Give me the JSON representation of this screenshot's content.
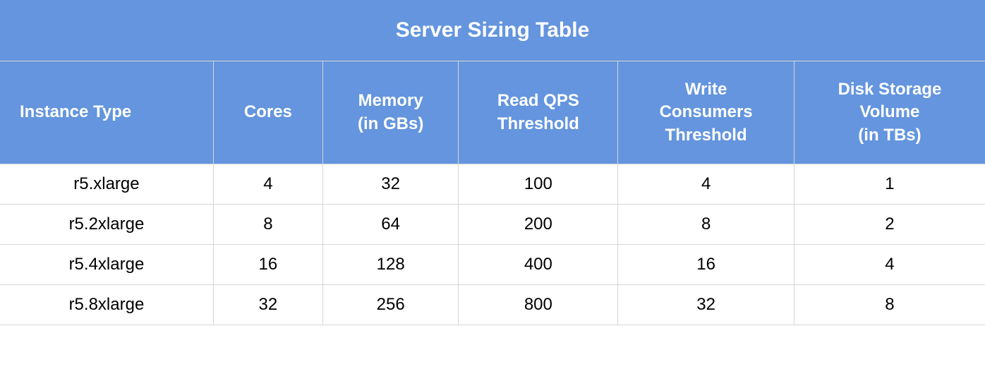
{
  "chart_data": {
    "type": "table",
    "title": "Server Sizing Table",
    "columns": [
      "Instance Type",
      "Cores",
      "Memory (in GBs)",
      "Read QPS Threshold",
      "Write Consumers Threshold",
      "Disk Storage Volume (in TBs)"
    ],
    "rows": [
      {
        "instance_type": "r5.xlarge",
        "cores": 4,
        "memory_gb": 32,
        "read_qps_threshold": 100,
        "write_consumers_threshold": 4,
        "disk_storage_tb": 1
      },
      {
        "instance_type": "r5.2xlarge",
        "cores": 8,
        "memory_gb": 64,
        "read_qps_threshold": 200,
        "write_consumers_threshold": 8,
        "disk_storage_tb": 2
      },
      {
        "instance_type": "r5.4xlarge",
        "cores": 16,
        "memory_gb": 128,
        "read_qps_threshold": 400,
        "write_consumers_threshold": 16,
        "disk_storage_tb": 4
      },
      {
        "instance_type": "r5.8xlarge",
        "cores": 32,
        "memory_gb": 256,
        "read_qps_threshold": 800,
        "write_consumers_threshold": 32,
        "disk_storage_tb": 8
      }
    ]
  },
  "headers": {
    "instance_type": "Instance Type",
    "cores": "Cores",
    "memory": "Memory\n(in GBs)",
    "read_qps": "Read QPS\nThreshold",
    "write_consumers": "Write\nConsumers\nThreshold",
    "disk_storage": "Disk Storage\nVolume\n(in TBs)"
  },
  "colors": {
    "header_bg": "#6495de",
    "header_fg": "#ffffff",
    "border": "#d6d6d6",
    "body_fg": "#000000"
  }
}
